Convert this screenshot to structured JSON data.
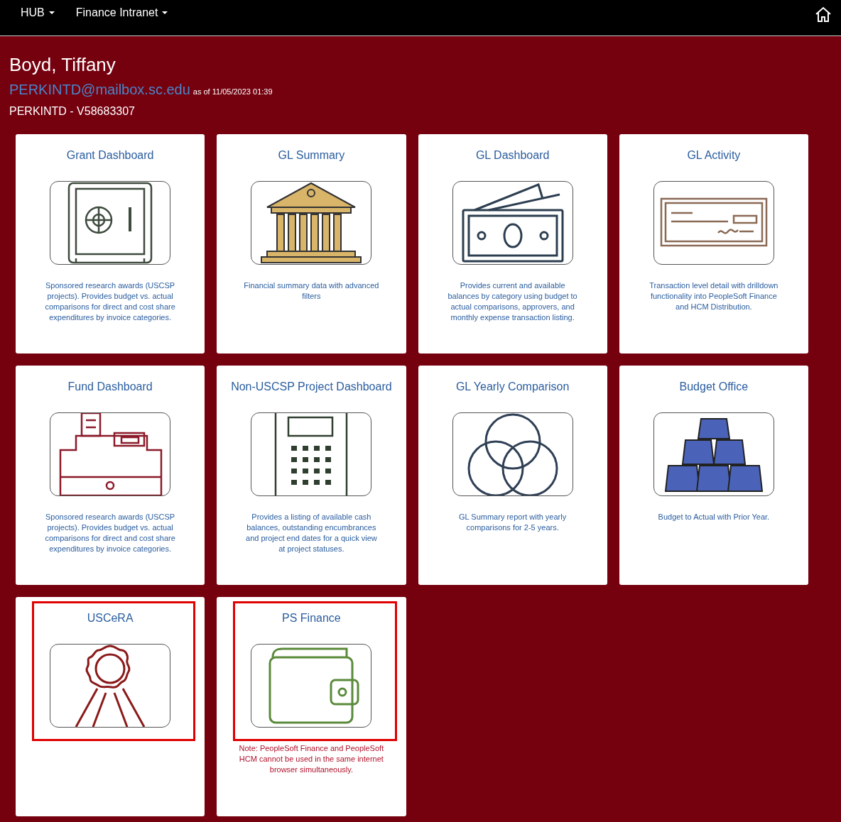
{
  "nav": {
    "menus": [
      {
        "label": "HUB"
      },
      {
        "label": "Finance Intranet"
      }
    ]
  },
  "user": {
    "name": "Boyd, Tiffany",
    "email": "PERKINTD@mailbox.sc.edu",
    "as_of": "as of 11/05/2023 01:39",
    "id_line": "PERKINTD - V58683307"
  },
  "tiles": [
    {
      "title": "Grant Dashboard",
      "description": "Sponsored research awards (USCSP projects). Provides budget vs. actual comparisons for direct and cost share expenditures by invoice categories.",
      "highlighted": false
    },
    {
      "title": "GL Summary",
      "description": "Financial summary data with advanced filters",
      "highlighted": false
    },
    {
      "title": "GL Dashboard",
      "description": "Provides current and available balances by category using budget to actual comparisons, approvers, and monthly expense transaction listing.",
      "highlighted": false
    },
    {
      "title": "GL Activity",
      "description": "Transaction level detail with drilldown functionality into PeopleSoft Finance and HCM Distribution.",
      "highlighted": false
    },
    {
      "title": "Fund Dashboard",
      "description": "Sponsored research awards (USCSP projects). Provides budget vs. actual comparisons for direct and cost share expenditures by invoice categories.",
      "highlighted": false
    },
    {
      "title": "Non-USCSP Project Dashboard",
      "description": "Provides a listing of available cash balances, outstanding encumbrances and project end dates for a quick view at project statuses.",
      "highlighted": false
    },
    {
      "title": "GL Yearly Comparison",
      "description": "GL Summary report with yearly comparisons for 2-5 years.",
      "highlighted": false
    },
    {
      "title": "Budget Office",
      "description": "Budget to Actual with Prior Year.",
      "highlighted": false
    },
    {
      "title": "USCeRA",
      "highlighted": true
    },
    {
      "title": "PS Finance",
      "note": "Note: PeopleSoft Finance and PeopleSoft HCM cannot be used in the same internet browser simultaneously.",
      "highlighted": true
    }
  ]
}
